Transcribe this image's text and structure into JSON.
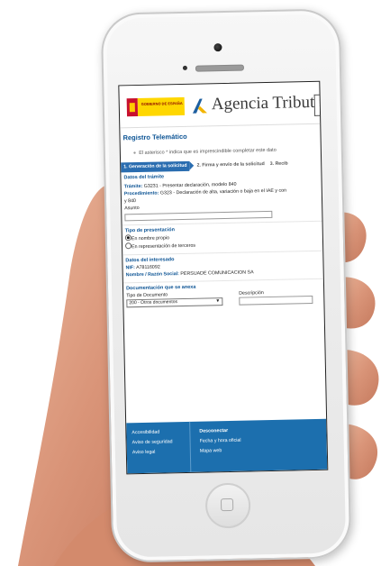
{
  "header": {
    "gov_label": "GOBIERNO DE ESPAÑA",
    "agency_name": "Agencia Tributaria"
  },
  "page": {
    "title": "Registro Telemático",
    "note": "El asterisco * indica que es imprescindible completar este dato"
  },
  "steps": [
    "1. Generación de la solicitud",
    "2. Firma y envío de la solicitud",
    "3. Recib"
  ],
  "tramite": {
    "heading": "Datos del trámite",
    "tramite_label": "Trámite:",
    "tramite_value": "G3231 - Presentar declaración, modelo 840",
    "procedimiento_label": "Procedimiento:",
    "procedimiento_value": "G323 - Declaración de alta, variación o baja en el IAE y con",
    "procedimiento_cont": "y 840",
    "asunto_label": "Asunto",
    "asunto_value": ""
  },
  "presentacion": {
    "heading": "Tipo de presentación",
    "options": [
      "En nombre propio",
      "En representación de terceros"
    ],
    "selected": 0
  },
  "interesado": {
    "heading": "Datos del interesado",
    "nif_label": "NIF:",
    "nif_value": "A78116092",
    "nombre_label": "Nombre / Razón Social:",
    "nombre_value": "PERSUADE COMUNICACION SA"
  },
  "documentacion": {
    "heading": "Documentación que se anexa",
    "tipo_label": "Tipo de Documento",
    "descripcion_label": "Descripción",
    "tipo_selected": "200 - Otros documentos",
    "descripcion_value": ""
  },
  "footer": {
    "col1": [
      "Accesibilidad",
      "Aviso de seguridad",
      "Aviso legal"
    ],
    "col2": [
      "Desconectar",
      "Fecha y hora oficial",
      "Mapa web"
    ]
  },
  "colors": {
    "accent": "#1c6fae",
    "link": "#0b5394"
  }
}
